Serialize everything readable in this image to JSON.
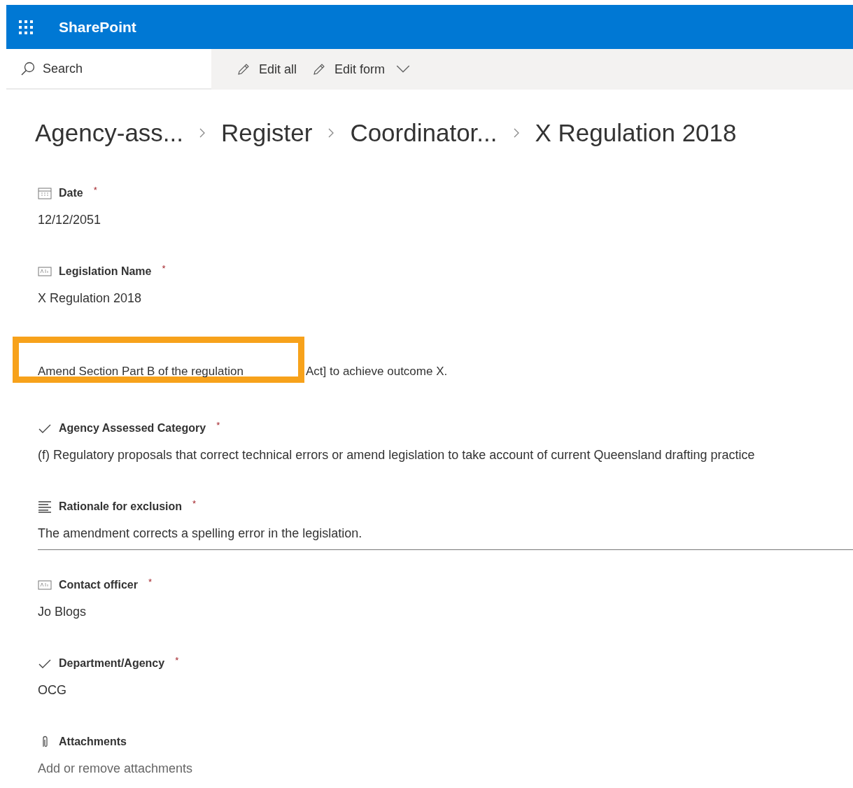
{
  "app_bar": {
    "title": "SharePoint"
  },
  "search": {
    "placeholder": "Search"
  },
  "command_bar": [
    {
      "label": "Edit all",
      "kind": "edit"
    },
    {
      "label": "Edit form",
      "kind": "edit-menu"
    }
  ],
  "breadcrumb": [
    "Agency-ass...",
    "Register",
    "Coordinator...",
    "X Regulation 2018"
  ],
  "fields": [
    {
      "kind": "date",
      "label": "Date",
      "asterisk": "*",
      "value": "12/12/2051"
    },
    {
      "kind": "text",
      "label": "Legislation Name",
      "asterisk": "*",
      "value": "X Regulation 2018"
    },
    {
      "kind": "highlighted",
      "value": "Amend Section Part B of the regulation",
      "value_continued": "Act] to achieve outcome X."
    },
    {
      "kind": "choice",
      "label": "Agency Assessed Category",
      "asterisk": "*",
      "value": "(f) Regulatory proposals that correct technical errors or amend legislation to take account of current Queensland drafting practice"
    },
    {
      "kind": "note",
      "label": "Rationale for exclusion",
      "asterisk": "*",
      "value": "The amendment corrects a spelling error in the legislation."
    },
    {
      "kind": "text",
      "label": "Contact officer",
      "asterisk": "*",
      "value": "Jo Blogs"
    },
    {
      "kind": "choice",
      "label": "Department/Agency",
      "asterisk": "*",
      "value": "OCG"
    },
    {
      "kind": "attachment",
      "label": "Attachments",
      "value": "Add or remove attachments"
    }
  ]
}
